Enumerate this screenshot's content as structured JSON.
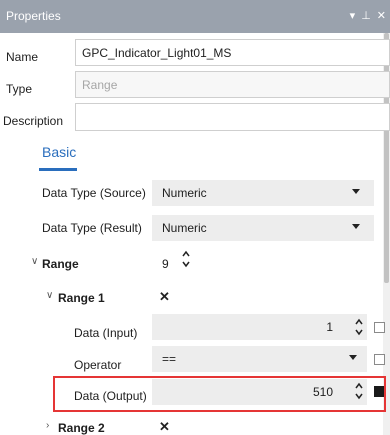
{
  "titlebar": {
    "title": "Properties",
    "pin_glyph": "▾ ⊥ ✕"
  },
  "fields": {
    "name_label": "Name",
    "name_value": "GPC_Indicator_Light01_MS",
    "type_label": "Type",
    "type_value": "Range",
    "description_label": "Description",
    "description_value": ""
  },
  "tab": {
    "label": "Basic"
  },
  "props": {
    "data_type_source_label": "Data Type (Source)",
    "data_type_source_value": "Numeric",
    "data_type_result_label": "Data Type (Result)",
    "data_type_result_value": "Numeric",
    "range_label": "Range",
    "range_value": "9",
    "range1_label": "Range 1",
    "range1_remove": "✕",
    "data_input_label": "Data (Input)",
    "data_input_value": "1",
    "operator_label": "Operator",
    "operator_value": "==",
    "data_output_label": "Data (Output)",
    "data_output_value": "510",
    "range2_label": "Range 2",
    "range2_remove": "✕"
  },
  "colors": {
    "titlebar": "#9aa2ad",
    "accent": "#2a6ebd",
    "highlight": "#e53535"
  },
  "icons": [
    "pin-icon",
    "close-icon",
    "dropdown-caret-icon",
    "spin-up-icon",
    "spin-down-icon",
    "expand-arrow-icon",
    "checkbox-icon"
  ]
}
